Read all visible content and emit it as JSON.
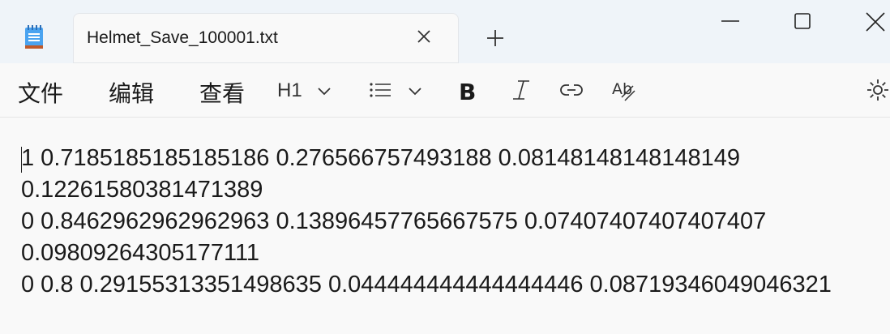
{
  "window": {
    "tab_title": "Helmet_Save_100001.txt"
  },
  "icons": {
    "app": "notepad-icon",
    "close_tab": "close-icon",
    "new_tab": "plus-icon",
    "minimize": "minimize-icon",
    "maximize": "maximize-icon",
    "close_window": "close-icon"
  },
  "toolbar": {
    "file": "文件",
    "edit": "编辑",
    "view": "查看",
    "heading": "H1"
  },
  "content": {
    "lines": [
      "1 0.7185185185185186 0.27656675749 3188 0.08148148148148149",
      "0.12261580381471389",
      "0 0.8462962962962963 0.13896457765667575 0.07407407407407407",
      "0.09809264305177111",
      "0 0.8 0.29155313351498635 0.044444444444444446 0.08719346049046321"
    ]
  },
  "colors": {
    "titlebar": "#eff4f9",
    "background": "#f9f9f9"
  }
}
